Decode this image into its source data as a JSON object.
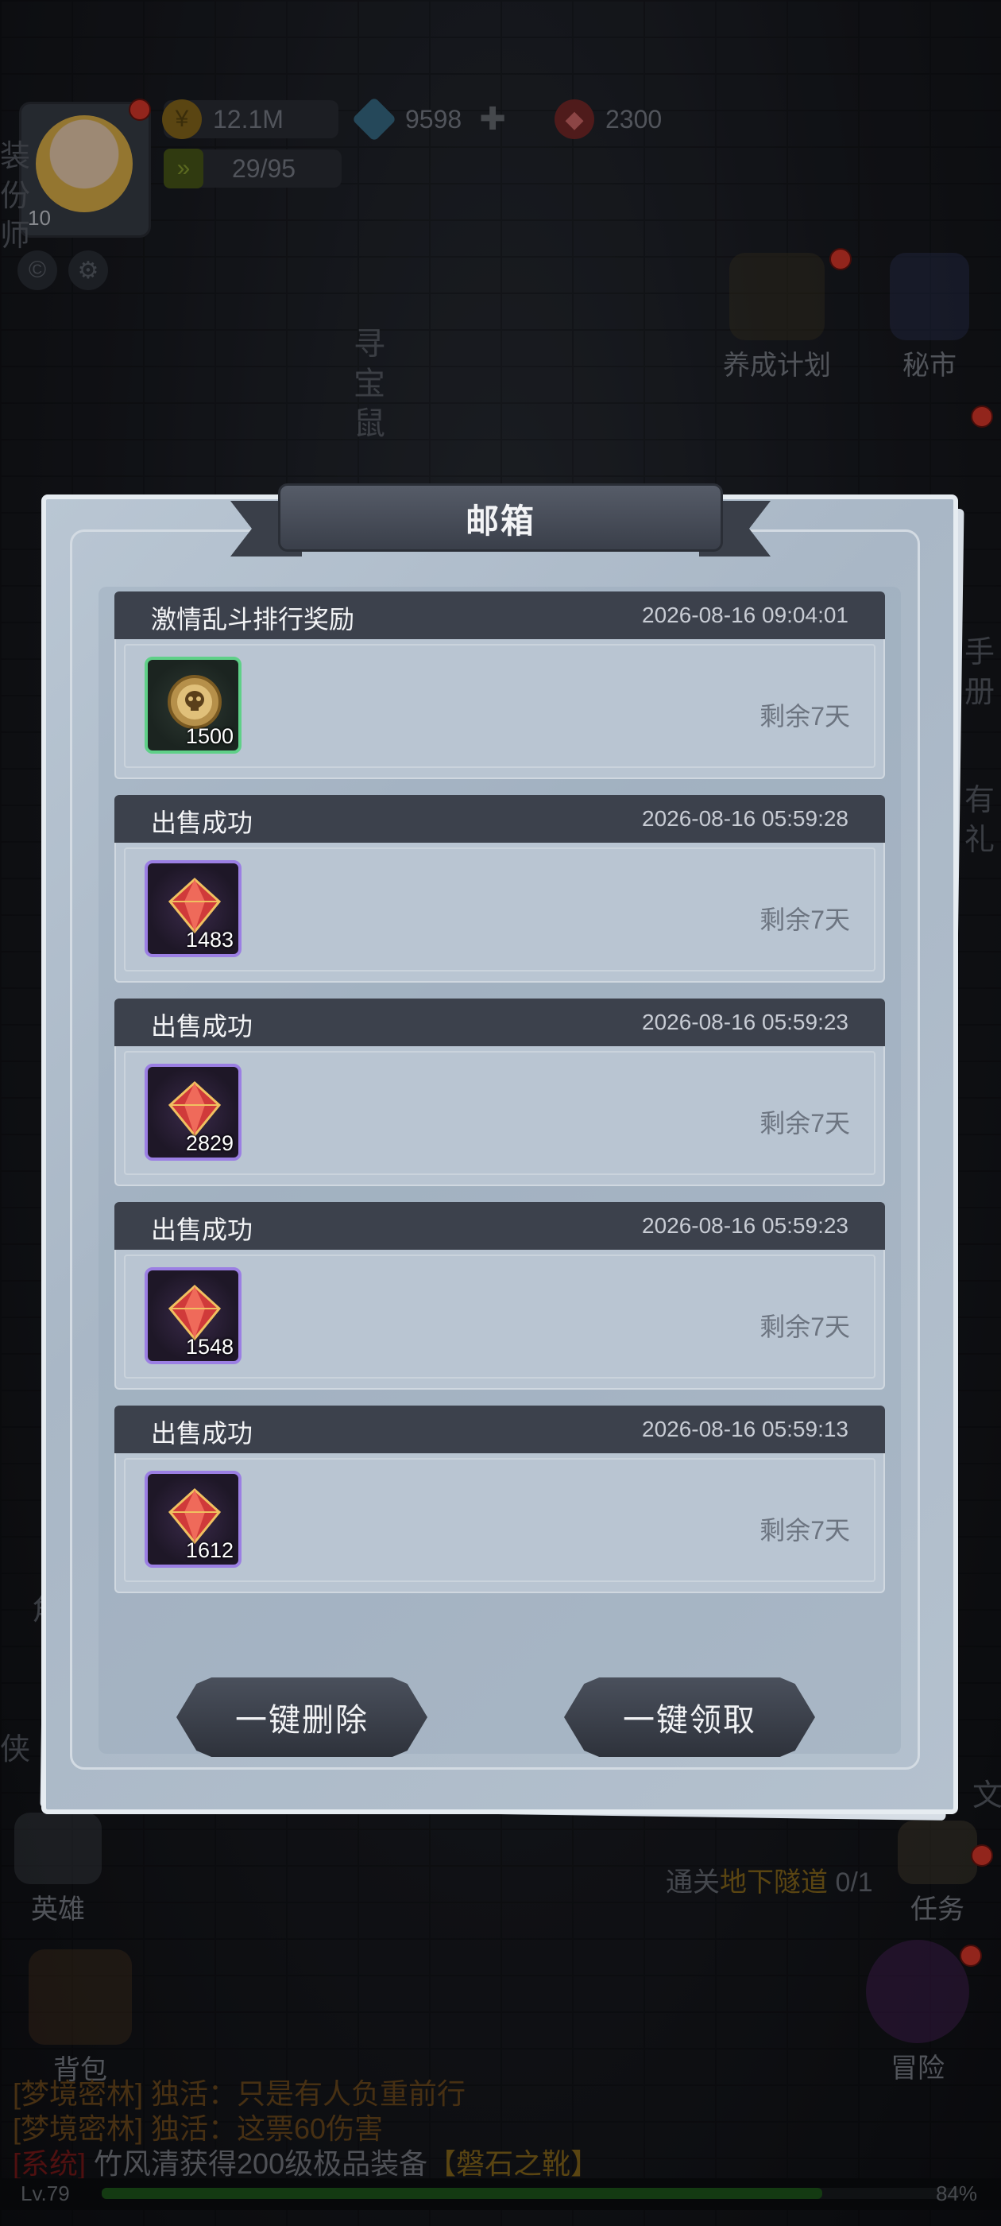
{
  "hud": {
    "avatar_level": "10",
    "gold": "12.1M",
    "diamonds": "9598",
    "gems": "2300",
    "stamina": "29/95",
    "side_text": [
      "装",
      "份",
      "师"
    ],
    "treasure_rat": "寻宝鼠",
    "nurture_plan": "养成计划",
    "secret_market": "秘市",
    "right_cut_1": "手册",
    "right_cut_2": "有礼",
    "right_cut_3": "文",
    "hero": "英雄",
    "task": "任务",
    "backpack": "背包",
    "adventure": "冒险",
    "left_cut_1": "侠",
    "left_cut_2": "角"
  },
  "task_progress": {
    "prefix": "通关",
    "place": "地下隧道",
    "count": "0/1"
  },
  "chat": [
    {
      "tag": "[梦境密林]",
      "text": "独活：只是有人负重前行",
      "kind": "normal"
    },
    {
      "tag": "[梦境密林]",
      "text": "独活：这票60伤害",
      "kind": "normal"
    },
    {
      "tag": "[系统]",
      "prefix": "竹风清获得200级极品装备",
      "item": "【磐石之靴】",
      "kind": "system"
    }
  ],
  "exp": {
    "level": "Lv.79",
    "percent": "84%",
    "fill": 0.84
  },
  "mailbox": {
    "title": "邮箱",
    "delete_all": "一键删除",
    "claim_all": "一键领取",
    "mails": [
      {
        "title": "激情乱斗排行奖励",
        "time": "2026-08-16 09:04:01",
        "item_qty": "1500",
        "item_icon": "skull-medal-icon",
        "rarity": "green",
        "remaining": "剩余7天"
      },
      {
        "title": "出售成功",
        "time": "2026-08-16 05:59:28",
        "item_qty": "1483",
        "item_icon": "red-gem-icon",
        "rarity": "purple",
        "remaining": "剩余7天"
      },
      {
        "title": "出售成功",
        "time": "2026-08-16 05:59:23",
        "item_qty": "2829",
        "item_icon": "red-gem-icon",
        "rarity": "purple",
        "remaining": "剩余7天"
      },
      {
        "title": "出售成功",
        "time": "2026-08-16 05:59:23",
        "item_qty": "1548",
        "item_icon": "red-gem-icon",
        "rarity": "purple",
        "remaining": "剩余7天"
      },
      {
        "title": "出售成功",
        "time": "2026-08-16 05:59:13",
        "item_qty": "1612",
        "item_icon": "red-gem-icon",
        "rarity": "purple",
        "remaining": "剩余7天"
      }
    ]
  },
  "colors": {
    "rarity_green": "#5fd088",
    "rarity_purple": "#9b7fe3",
    "mail_header": "#3c414c",
    "gold_text": "#8a6a1c"
  }
}
